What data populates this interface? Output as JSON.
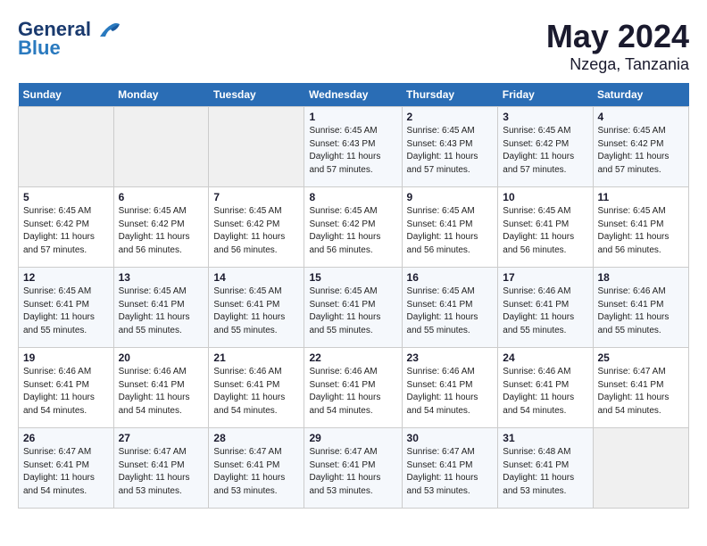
{
  "header": {
    "logo_line1": "General",
    "logo_line2": "Blue",
    "month": "May 2024",
    "location": "Nzega, Tanzania"
  },
  "weekdays": [
    "Sunday",
    "Monday",
    "Tuesday",
    "Wednesday",
    "Thursday",
    "Friday",
    "Saturday"
  ],
  "weeks": [
    [
      {
        "day": "",
        "info": ""
      },
      {
        "day": "",
        "info": ""
      },
      {
        "day": "",
        "info": ""
      },
      {
        "day": "1",
        "info": "Sunrise: 6:45 AM\nSunset: 6:43 PM\nDaylight: 11 hours\nand 57 minutes."
      },
      {
        "day": "2",
        "info": "Sunrise: 6:45 AM\nSunset: 6:43 PM\nDaylight: 11 hours\nand 57 minutes."
      },
      {
        "day": "3",
        "info": "Sunrise: 6:45 AM\nSunset: 6:42 PM\nDaylight: 11 hours\nand 57 minutes."
      },
      {
        "day": "4",
        "info": "Sunrise: 6:45 AM\nSunset: 6:42 PM\nDaylight: 11 hours\nand 57 minutes."
      }
    ],
    [
      {
        "day": "5",
        "info": "Sunrise: 6:45 AM\nSunset: 6:42 PM\nDaylight: 11 hours\nand 57 minutes."
      },
      {
        "day": "6",
        "info": "Sunrise: 6:45 AM\nSunset: 6:42 PM\nDaylight: 11 hours\nand 56 minutes."
      },
      {
        "day": "7",
        "info": "Sunrise: 6:45 AM\nSunset: 6:42 PM\nDaylight: 11 hours\nand 56 minutes."
      },
      {
        "day": "8",
        "info": "Sunrise: 6:45 AM\nSunset: 6:42 PM\nDaylight: 11 hours\nand 56 minutes."
      },
      {
        "day": "9",
        "info": "Sunrise: 6:45 AM\nSunset: 6:41 PM\nDaylight: 11 hours\nand 56 minutes."
      },
      {
        "day": "10",
        "info": "Sunrise: 6:45 AM\nSunset: 6:41 PM\nDaylight: 11 hours\nand 56 minutes."
      },
      {
        "day": "11",
        "info": "Sunrise: 6:45 AM\nSunset: 6:41 PM\nDaylight: 11 hours\nand 56 minutes."
      }
    ],
    [
      {
        "day": "12",
        "info": "Sunrise: 6:45 AM\nSunset: 6:41 PM\nDaylight: 11 hours\nand 55 minutes."
      },
      {
        "day": "13",
        "info": "Sunrise: 6:45 AM\nSunset: 6:41 PM\nDaylight: 11 hours\nand 55 minutes."
      },
      {
        "day": "14",
        "info": "Sunrise: 6:45 AM\nSunset: 6:41 PM\nDaylight: 11 hours\nand 55 minutes."
      },
      {
        "day": "15",
        "info": "Sunrise: 6:45 AM\nSunset: 6:41 PM\nDaylight: 11 hours\nand 55 minutes."
      },
      {
        "day": "16",
        "info": "Sunrise: 6:45 AM\nSunset: 6:41 PM\nDaylight: 11 hours\nand 55 minutes."
      },
      {
        "day": "17",
        "info": "Sunrise: 6:46 AM\nSunset: 6:41 PM\nDaylight: 11 hours\nand 55 minutes."
      },
      {
        "day": "18",
        "info": "Sunrise: 6:46 AM\nSunset: 6:41 PM\nDaylight: 11 hours\nand 55 minutes."
      }
    ],
    [
      {
        "day": "19",
        "info": "Sunrise: 6:46 AM\nSunset: 6:41 PM\nDaylight: 11 hours\nand 54 minutes."
      },
      {
        "day": "20",
        "info": "Sunrise: 6:46 AM\nSunset: 6:41 PM\nDaylight: 11 hours\nand 54 minutes."
      },
      {
        "day": "21",
        "info": "Sunrise: 6:46 AM\nSunset: 6:41 PM\nDaylight: 11 hours\nand 54 minutes."
      },
      {
        "day": "22",
        "info": "Sunrise: 6:46 AM\nSunset: 6:41 PM\nDaylight: 11 hours\nand 54 minutes."
      },
      {
        "day": "23",
        "info": "Sunrise: 6:46 AM\nSunset: 6:41 PM\nDaylight: 11 hours\nand 54 minutes."
      },
      {
        "day": "24",
        "info": "Sunrise: 6:46 AM\nSunset: 6:41 PM\nDaylight: 11 hours\nand 54 minutes."
      },
      {
        "day": "25",
        "info": "Sunrise: 6:47 AM\nSunset: 6:41 PM\nDaylight: 11 hours\nand 54 minutes."
      }
    ],
    [
      {
        "day": "26",
        "info": "Sunrise: 6:47 AM\nSunset: 6:41 PM\nDaylight: 11 hours\nand 54 minutes."
      },
      {
        "day": "27",
        "info": "Sunrise: 6:47 AM\nSunset: 6:41 PM\nDaylight: 11 hours\nand 53 minutes."
      },
      {
        "day": "28",
        "info": "Sunrise: 6:47 AM\nSunset: 6:41 PM\nDaylight: 11 hours\nand 53 minutes."
      },
      {
        "day": "29",
        "info": "Sunrise: 6:47 AM\nSunset: 6:41 PM\nDaylight: 11 hours\nand 53 minutes."
      },
      {
        "day": "30",
        "info": "Sunrise: 6:47 AM\nSunset: 6:41 PM\nDaylight: 11 hours\nand 53 minutes."
      },
      {
        "day": "31",
        "info": "Sunrise: 6:48 AM\nSunset: 6:41 PM\nDaylight: 11 hours\nand 53 minutes."
      },
      {
        "day": "",
        "info": ""
      }
    ]
  ]
}
